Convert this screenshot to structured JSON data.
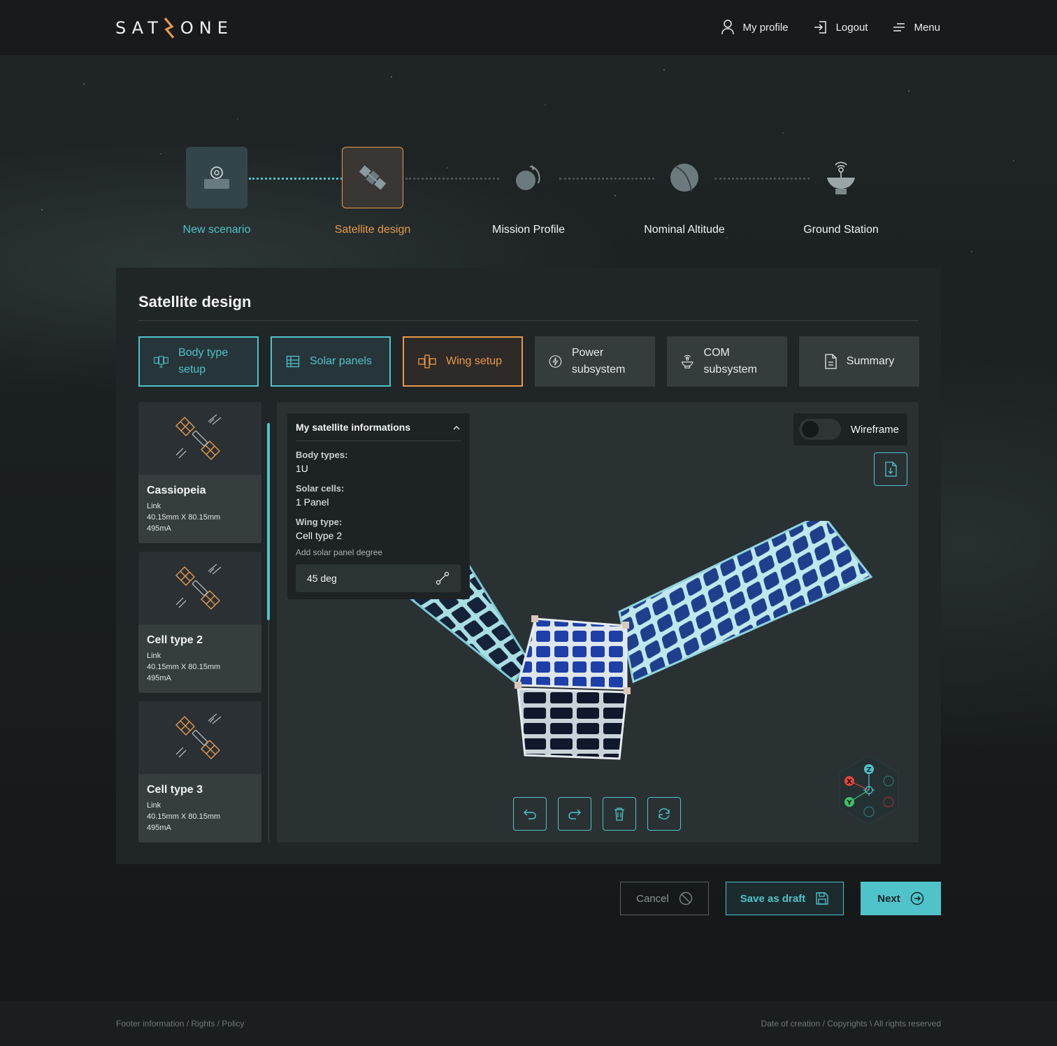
{
  "header": {
    "logo_left": "SAT",
    "logo_right": "ONE",
    "nav": [
      {
        "label": "My profile",
        "icon": "user-icon"
      },
      {
        "label": "Logout",
        "icon": "logout-icon"
      },
      {
        "label": "Menu",
        "icon": "menu-icon"
      }
    ]
  },
  "steps": [
    {
      "label": "New scenario",
      "state": "done",
      "icon": "gear-icon"
    },
    {
      "label": "Satellite design",
      "state": "active",
      "icon": "satellite-icon"
    },
    {
      "label": "Mission Profile",
      "state": "todo",
      "icon": "planet-orbit-icon"
    },
    {
      "label": "Nominal Altitude",
      "state": "todo",
      "icon": "planet-icon"
    },
    {
      "label": "Ground Station",
      "state": "todo",
      "icon": "dish-icon"
    }
  ],
  "panel": {
    "title": "Satellite design",
    "tabs": [
      {
        "label": "Body type setup",
        "state": "done"
      },
      {
        "label": "Solar panels",
        "state": "done"
      },
      {
        "label": "Wing setup",
        "state": "active"
      },
      {
        "label": "Power subsystem",
        "state": "todo"
      },
      {
        "label": "COM subsystem",
        "state": "todo"
      },
      {
        "label": "Summary",
        "state": "todo"
      }
    ]
  },
  "cards": [
    {
      "title": "Cassiopeia",
      "link": "Link",
      "dims": "40.15mm X 80.15mm",
      "current": "495mA"
    },
    {
      "title": "Cell type 2",
      "link": "Link",
      "dims": "40.15mm X 80.15mm",
      "current": "495mA"
    },
    {
      "title": "Cell type 3",
      "link": "Link",
      "dims": "40.15mm X 80.15mm",
      "current": "495mA"
    }
  ],
  "info": {
    "title": "My satellite informations",
    "body_types_label": "Body types:",
    "body_types_value": "1U",
    "solar_cells_label": "Solar cells:",
    "solar_cells_value": "1 Panel",
    "wing_type_label": "Wing type:",
    "wing_type_value": "Cell type 2",
    "degree_hint": "Add solar panel degree",
    "degree_value": "45 deg"
  },
  "viewer": {
    "wireframe_label": "Wireframe",
    "wireframe_on": false,
    "gizmo_axes": [
      "Z",
      "X",
      "Y"
    ]
  },
  "actions": {
    "cancel": "Cancel",
    "save_draft": "Save as draft",
    "next": "Next"
  },
  "footer": {
    "left": "Footer information / Rights / Policy",
    "right": "Date of creation / Copyrights \\ All rights reserved"
  },
  "colors": {
    "accent_teal": "#4fc3c9",
    "accent_orange": "#e89a4a",
    "gizmo_x": "#e0463c",
    "gizmo_y": "#3fbf6a",
    "gizmo_z": "#4fc3c9"
  }
}
